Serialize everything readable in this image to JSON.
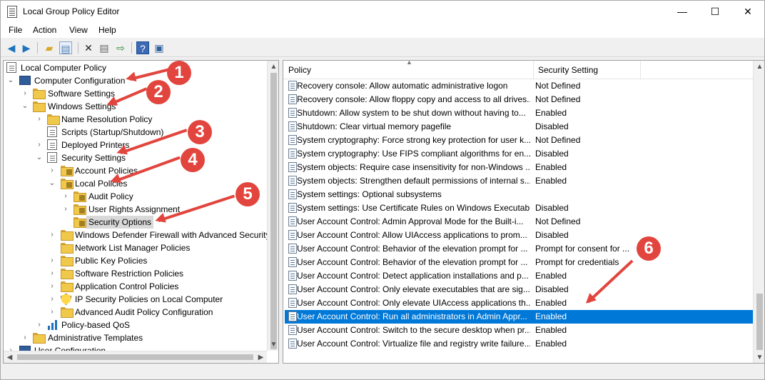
{
  "window": {
    "title": "Local Group Policy Editor",
    "controls": {
      "minimize": "—",
      "maximize": "☐",
      "close": "✕"
    }
  },
  "menu": [
    "File",
    "Action",
    "View",
    "Help"
  ],
  "toolbar": {
    "icons": [
      "back-arrow-icon",
      "forward-arrow-icon",
      "folder-up-icon",
      "show-hide-tree-icon",
      "delete-icon",
      "properties-icon",
      "export-list-icon",
      "help-icon",
      "console-icon"
    ]
  },
  "tree": {
    "items": [
      {
        "label": "Local Computer Policy"
      },
      {
        "label": "Computer Configuration"
      },
      {
        "label": "Software Settings"
      },
      {
        "label": "Windows Settings"
      },
      {
        "label": "Name Resolution Policy"
      },
      {
        "label": "Scripts (Startup/Shutdown)"
      },
      {
        "label": "Deployed Printers"
      },
      {
        "label": "Security Settings"
      },
      {
        "label": "Account Policies"
      },
      {
        "label": "Local Policies"
      },
      {
        "label": "Audit Policy"
      },
      {
        "label": "User Rights Assignment"
      },
      {
        "label": "Security Options"
      },
      {
        "label": "Windows Defender Firewall with Advanced Security"
      },
      {
        "label": "Network List Manager Policies"
      },
      {
        "label": "Public Key Policies"
      },
      {
        "label": "Software Restriction Policies"
      },
      {
        "label": "Application Control Policies"
      },
      {
        "label": "IP Security Policies on Local Computer"
      },
      {
        "label": "Advanced Audit Policy Configuration"
      },
      {
        "label": "Policy-based QoS"
      },
      {
        "label": "Administrative Templates"
      },
      {
        "label": "User Configuration"
      }
    ]
  },
  "policy_table": {
    "columns": [
      "Policy",
      "Security Setting"
    ],
    "rows": [
      {
        "policy": "Recovery console: Allow automatic administrative logon",
        "setting": "Not Defined"
      },
      {
        "policy": "Recovery console: Allow floppy copy and access to all drives...",
        "setting": "Not Defined"
      },
      {
        "policy": "Shutdown: Allow system to be shut down without having to...",
        "setting": "Enabled"
      },
      {
        "policy": "Shutdown: Clear virtual memory pagefile",
        "setting": "Disabled"
      },
      {
        "policy": "System cryptography: Force strong key protection for user k...",
        "setting": "Not Defined"
      },
      {
        "policy": "System cryptography: Use FIPS compliant algorithms for en...",
        "setting": "Disabled"
      },
      {
        "policy": "System objects: Require case insensitivity for non-Windows ...",
        "setting": "Enabled"
      },
      {
        "policy": "System objects: Strengthen default permissions of internal s...",
        "setting": "Enabled"
      },
      {
        "policy": "System settings: Optional subsystems",
        "setting": ""
      },
      {
        "policy": "System settings: Use Certificate Rules on Windows Executab...",
        "setting": "Disabled"
      },
      {
        "policy": "User Account Control: Admin Approval Mode for the Built-i...",
        "setting": "Not Defined"
      },
      {
        "policy": "User Account Control: Allow UIAccess applications to prom...",
        "setting": "Disabled"
      },
      {
        "policy": "User Account Control: Behavior of the elevation prompt for ...",
        "setting": "Prompt for consent for ..."
      },
      {
        "policy": "User Account Control: Behavior of the elevation prompt for ...",
        "setting": "Prompt for credentials"
      },
      {
        "policy": "User Account Control: Detect application installations and p...",
        "setting": "Enabled"
      },
      {
        "policy": "User Account Control: Only elevate executables that are sig...",
        "setting": "Disabled"
      },
      {
        "policy": "User Account Control: Only elevate UIAccess applications th...",
        "setting": "Enabled"
      },
      {
        "policy": "User Account Control: Run all administrators in Admin Appr...",
        "setting": "Enabled"
      },
      {
        "policy": "User Account Control: Switch to the secure desktop when pr...",
        "setting": "Enabled"
      },
      {
        "policy": "User Account Control: Virtualize file and registry write failure...",
        "setting": "Enabled"
      }
    ]
  },
  "callouts": [
    "1",
    "2",
    "3",
    "4",
    "5",
    "6"
  ],
  "colors": {
    "selection": "#0078d7",
    "callout": "#e2453d"
  }
}
